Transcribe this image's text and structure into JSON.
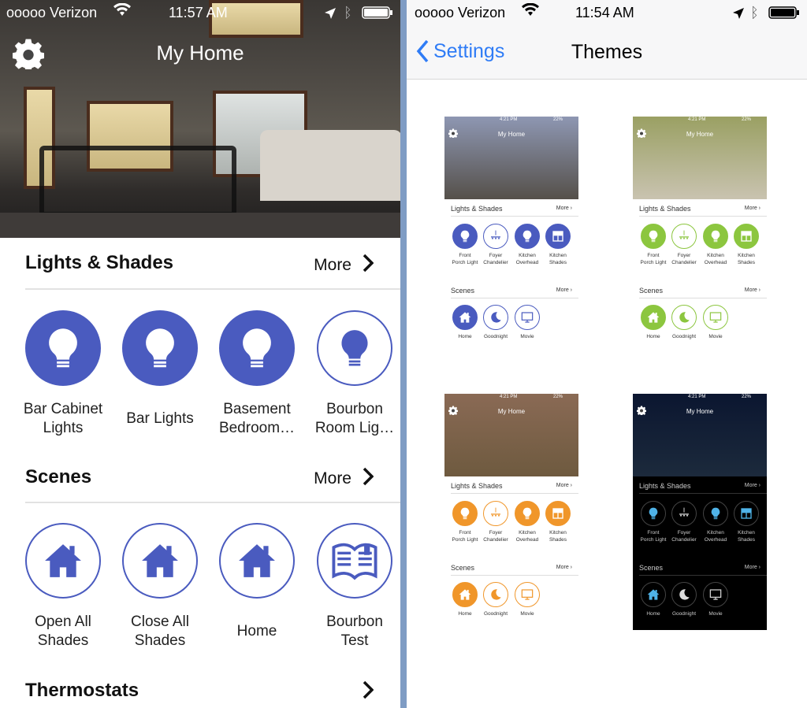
{
  "left": {
    "status": {
      "carrier": "ooooo Verizon",
      "time": "11:57 AM"
    },
    "title": "My Home",
    "lights": {
      "title": "Lights & Shades",
      "more": "More",
      "items": [
        {
          "label": "Bar Cabinet\nLights",
          "icon": "bulb",
          "on": true
        },
        {
          "label": "Bar Lights",
          "icon": "bulb",
          "on": true
        },
        {
          "label": "Basement\nBedroom…",
          "icon": "bulb",
          "on": true
        },
        {
          "label": "Bourbon\nRoom Lig…",
          "icon": "bulb",
          "on": false
        }
      ]
    },
    "scenes": {
      "title": "Scenes",
      "more": "More",
      "items": [
        {
          "label": "Open All\nShades",
          "icon": "house"
        },
        {
          "label": "Close All\nShades",
          "icon": "house"
        },
        {
          "label": "Home",
          "icon": "house"
        },
        {
          "label": "Bourbon\nTest",
          "icon": "book"
        }
      ]
    },
    "thermostats": {
      "title": "Thermostats"
    }
  },
  "right": {
    "status": {
      "carrier": "ooooo Verizon",
      "time": "11:54 AM"
    },
    "back": "Settings",
    "title": "Themes",
    "thumb_text": {
      "time": "4:21 PM",
      "battery": "22%",
      "title": "My Home",
      "lights": "Lights & Shades",
      "scenes": "Scenes",
      "more": "More",
      "lights_items": [
        {
          "label": "Front\nPorch Light",
          "icon": "bulb",
          "on": true
        },
        {
          "label": "Foyer\nChandelier",
          "icon": "chandelier",
          "on": false
        },
        {
          "label": "Kitchen\nOverhead",
          "icon": "bulb",
          "on": true
        },
        {
          "label": "Kitchen\nShades",
          "icon": "shade",
          "on": true
        }
      ],
      "scene_items": [
        {
          "label": "Home",
          "icon": "house",
          "on": true
        },
        {
          "label": "Goodnight",
          "icon": "moon",
          "on": false
        },
        {
          "label": "Movie",
          "icon": "monitor",
          "on": false
        }
      ]
    },
    "themes": [
      {
        "name": "blue",
        "accent": "#4a5bbf",
        "bg": "#ffffff",
        "text": "#222222",
        "hero": [
          "#8e97b3",
          "#55504a"
        ]
      },
      {
        "name": "green",
        "accent": "#8cc63f",
        "bg": "#ffffff",
        "text": "#222222",
        "hero": [
          "#9aa063",
          "#c9c3b0"
        ]
      },
      {
        "name": "orange",
        "accent": "#f0962a",
        "bg": "#ffffff",
        "text": "#222222",
        "hero": [
          "#8a6a55",
          "#6e5a3f"
        ]
      },
      {
        "name": "dark",
        "accent": "#4fb3e8",
        "bg": "#000000",
        "text": "#e6e6e6",
        "hero": [
          "#0b1630",
          "#1c2a3c"
        ]
      }
    ]
  },
  "colors": {
    "accent": "#4a5bbf",
    "ios_blue": "#2f7cf6",
    "divider": "#7f9cc4"
  }
}
